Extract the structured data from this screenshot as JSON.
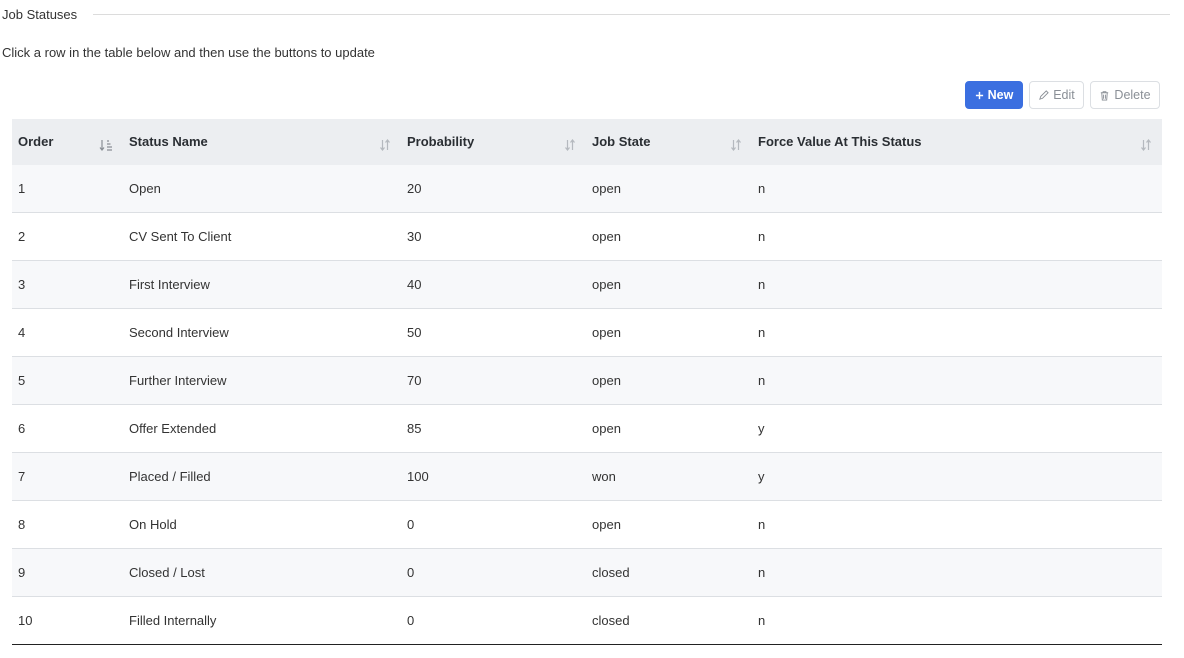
{
  "section": {
    "title": "Job Statuses"
  },
  "instructions": "Click a row in the table below and then use the buttons to update",
  "toolbar": {
    "new_label": "New",
    "edit_label": "Edit",
    "delete_label": "Delete"
  },
  "colors": {
    "accent": "#3b6fe0",
    "header_bg": "#eceef1",
    "row_alt": "#f7f8fa"
  },
  "table": {
    "columns": [
      "Order",
      "Status Name",
      "Probability",
      "Job State",
      "Force Value At This Status"
    ],
    "rows": [
      [
        "1",
        "Open",
        "20",
        "open",
        "n"
      ],
      [
        "2",
        "CV Sent To Client",
        "30",
        "open",
        "n"
      ],
      [
        "3",
        "First Interview",
        "40",
        "open",
        "n"
      ],
      [
        "4",
        "Second Interview",
        "50",
        "open",
        "n"
      ],
      [
        "5",
        "Further Interview",
        "70",
        "open",
        "n"
      ],
      [
        "6",
        "Offer Extended",
        "85",
        "open",
        "y"
      ],
      [
        "7",
        "Placed / Filled",
        "100",
        "won",
        "y"
      ],
      [
        "8",
        "On Hold",
        "0",
        "open",
        "n"
      ],
      [
        "9",
        "Closed / Lost",
        "0",
        "closed",
        "n"
      ],
      [
        "10",
        "Filled Internally",
        "0",
        "closed",
        "n"
      ]
    ]
  }
}
